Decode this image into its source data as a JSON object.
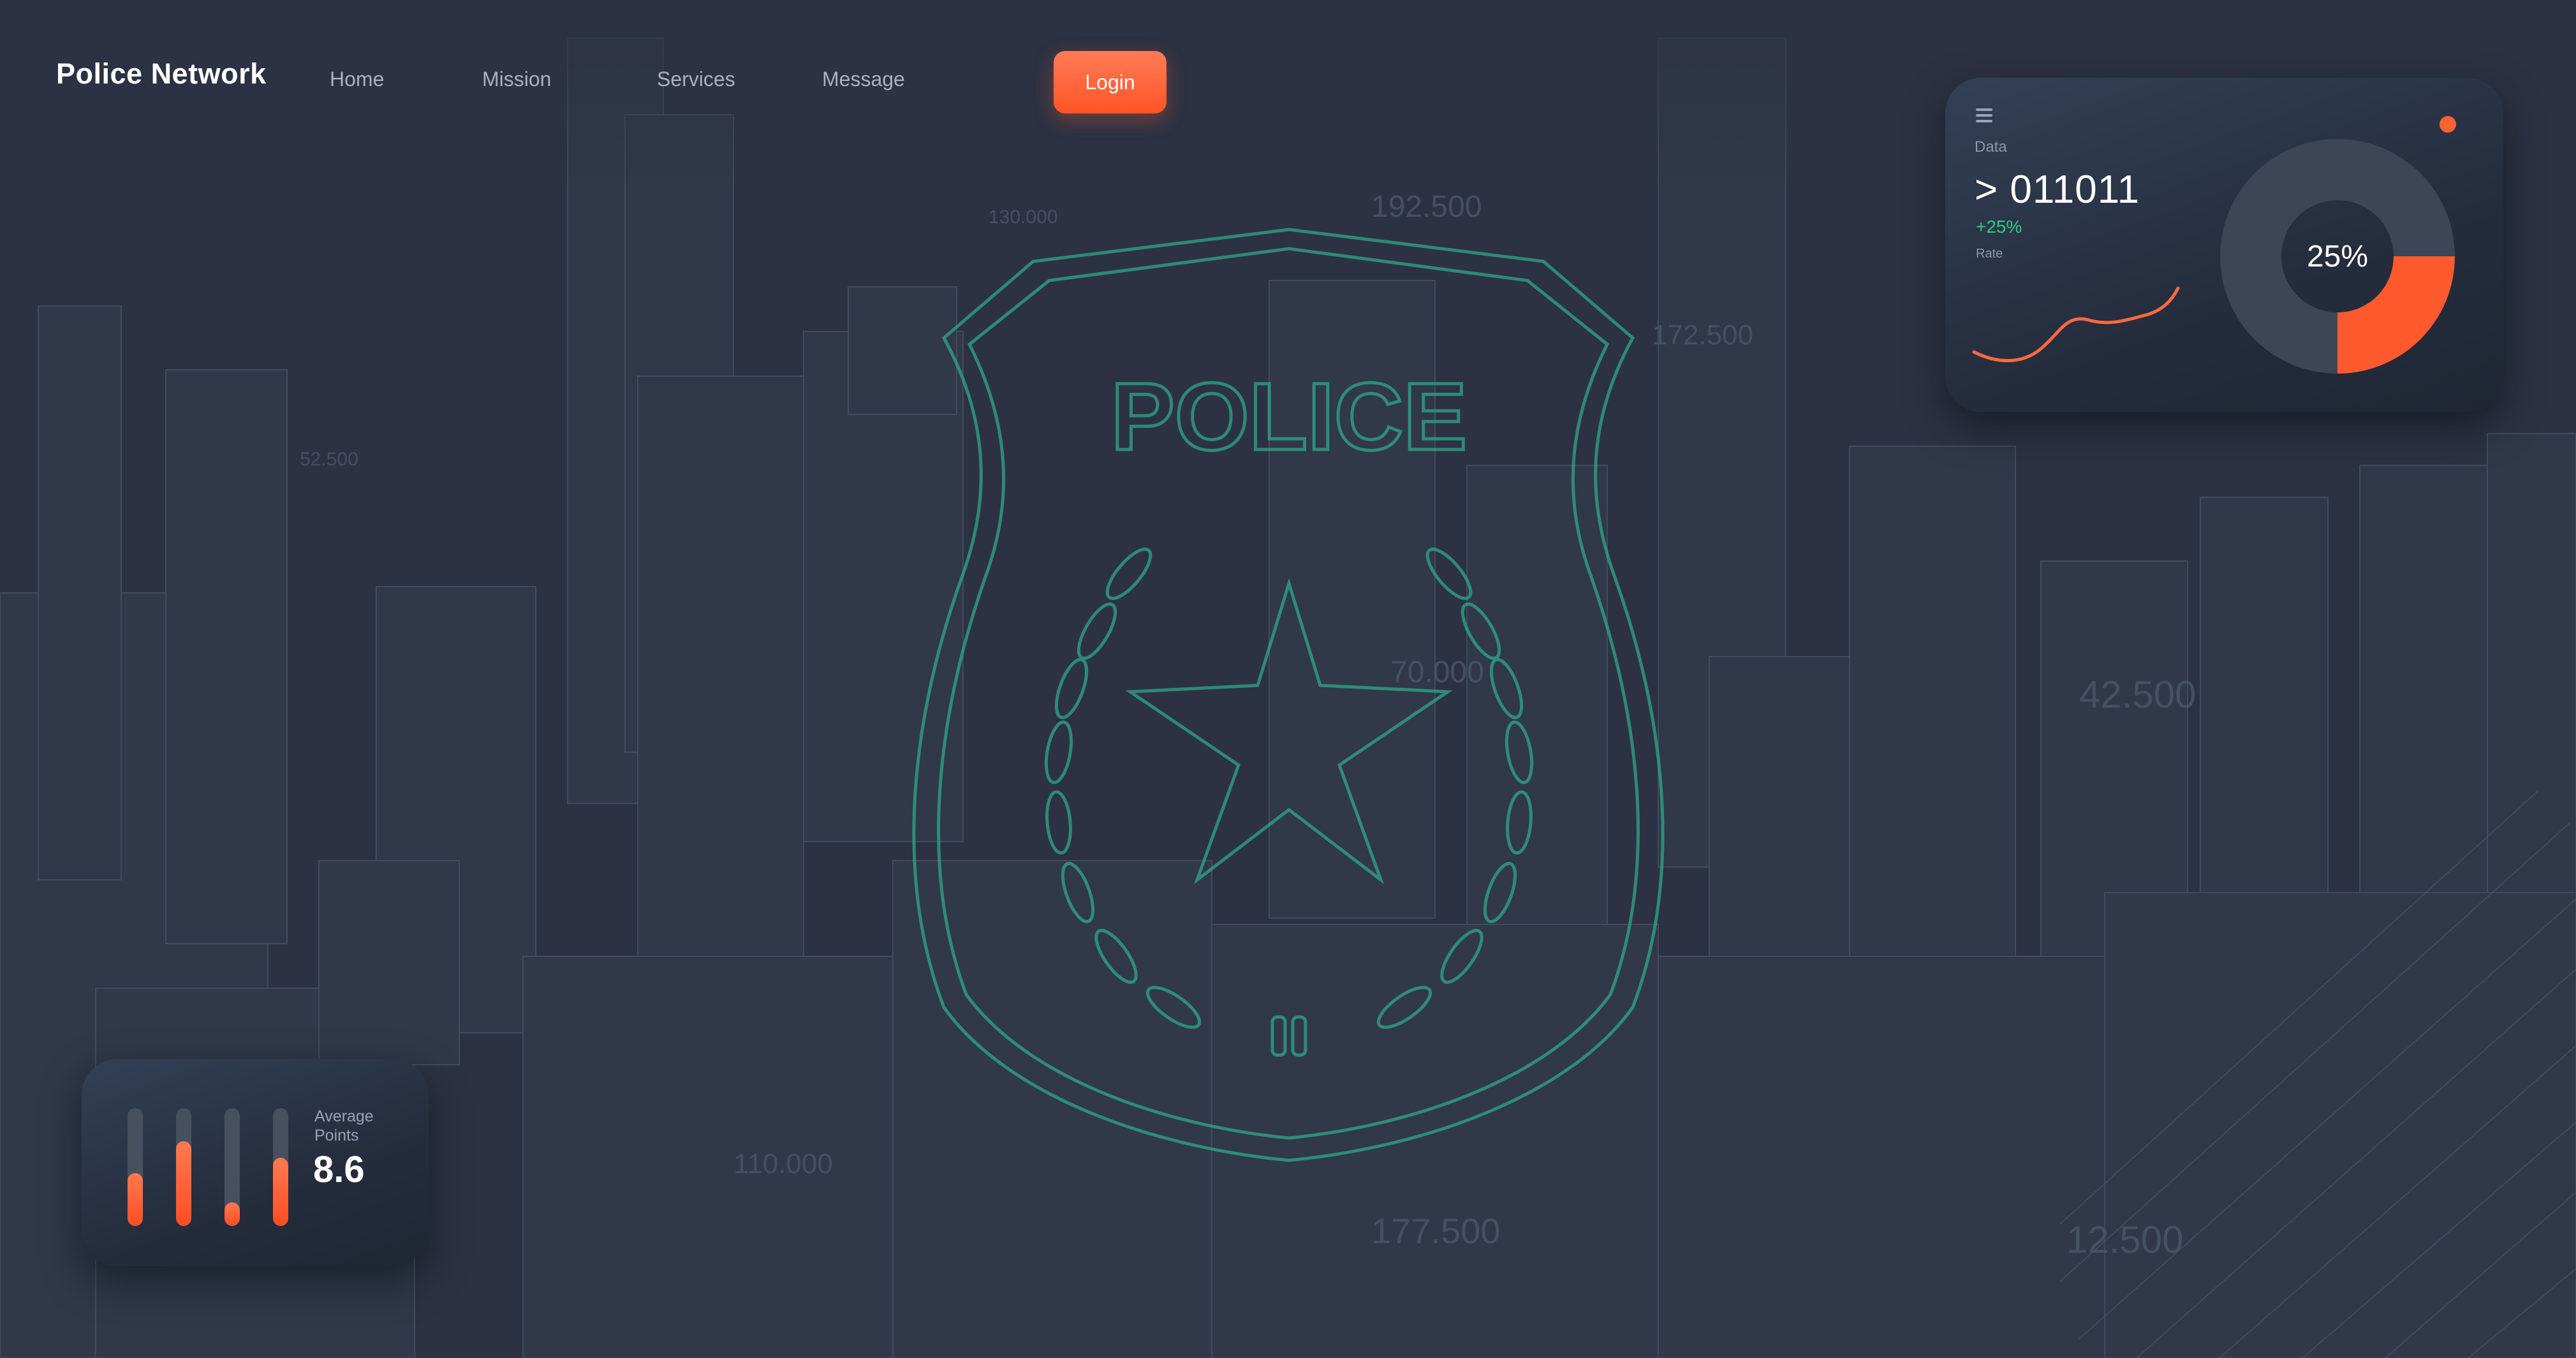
{
  "brand": "Police Network",
  "nav": {
    "links": [
      "Home",
      "Mission",
      "Services",
      "Message"
    ],
    "login_label": "Login"
  },
  "badge": {
    "text": "POLICE"
  },
  "background_numbers": [
    "130.000",
    "192.500",
    "172.500",
    "52.500",
    "70.000",
    "42.500",
    "110.000",
    "177.500",
    "12.500"
  ],
  "data_card": {
    "title": "Data",
    "value": "> 011011",
    "change": "+25%",
    "rate_label": "Rate",
    "donut_percent": 0.25,
    "donut_label": "25%"
  },
  "points_card": {
    "label_line1": "Average",
    "label_line2": "Points",
    "value": "8.6",
    "bar_levels": [
      0.45,
      0.72,
      0.2,
      0.58
    ]
  },
  "colors": {
    "background": "#2c3243",
    "accent": "#ff5a2d",
    "badge": "#2fa78c",
    "positive": "#2fcb86"
  },
  "icons": [
    "menu-icon",
    "status-dot",
    "police-badge-icon",
    "star-icon",
    "laurel-icon"
  ]
}
